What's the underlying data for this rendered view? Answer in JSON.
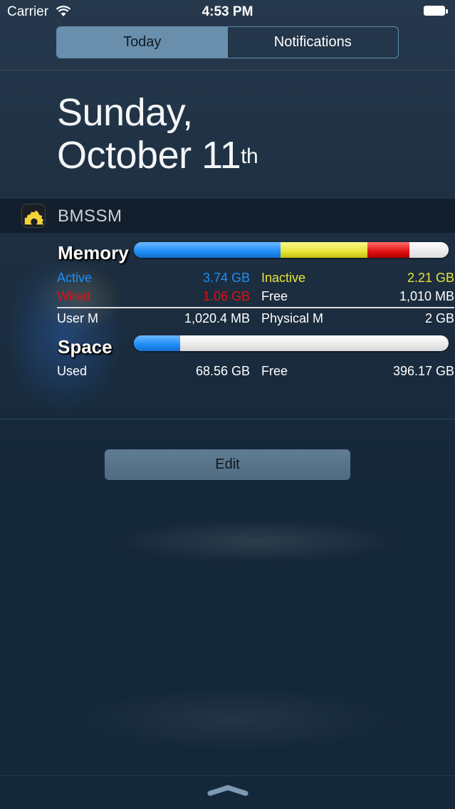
{
  "status_bar": {
    "carrier": "Carrier",
    "time": "4:53 PM"
  },
  "tabs": [
    {
      "label": "Today",
      "selected": true
    },
    {
      "label": "Notifications",
      "selected": false
    }
  ],
  "date": {
    "line1": "Sunday,",
    "line2_main": "October 11",
    "line2_suffix": "th"
  },
  "widget": {
    "app_name": "BMSSM",
    "memory": {
      "title": "Memory",
      "active": {
        "label": "Active",
        "value": "3.74 GB",
        "color": "#1f8cf5"
      },
      "inactive": {
        "label": "Inactive",
        "value": "2.21 GB",
        "color": "#e8e43a"
      },
      "wired": {
        "label": "Wired",
        "value": "1.06 GB",
        "color": "#e01010"
      },
      "free": {
        "label": "Free",
        "value": "1,010 MB"
      },
      "user": {
        "label": "User M",
        "value": "1,020.4 MB"
      },
      "physical": {
        "label": "Physical M",
        "value": "2 GB"
      },
      "bar_fractions": {
        "active": 0.467,
        "inactive": 0.276,
        "wired": 0.133,
        "free": 0.124
      }
    },
    "space": {
      "title": "Space",
      "used": {
        "label": "Used",
        "value": "68.56 GB"
      },
      "free": {
        "label": "Free",
        "value": "396.17 GB"
      },
      "bar_fractions": {
        "used": 0.147
      }
    }
  },
  "edit_button": "Edit",
  "colors": {
    "active": "#1f8cf5",
    "inactive": "#e8e43a",
    "wired": "#e01010",
    "free_bar": "#ececec"
  }
}
